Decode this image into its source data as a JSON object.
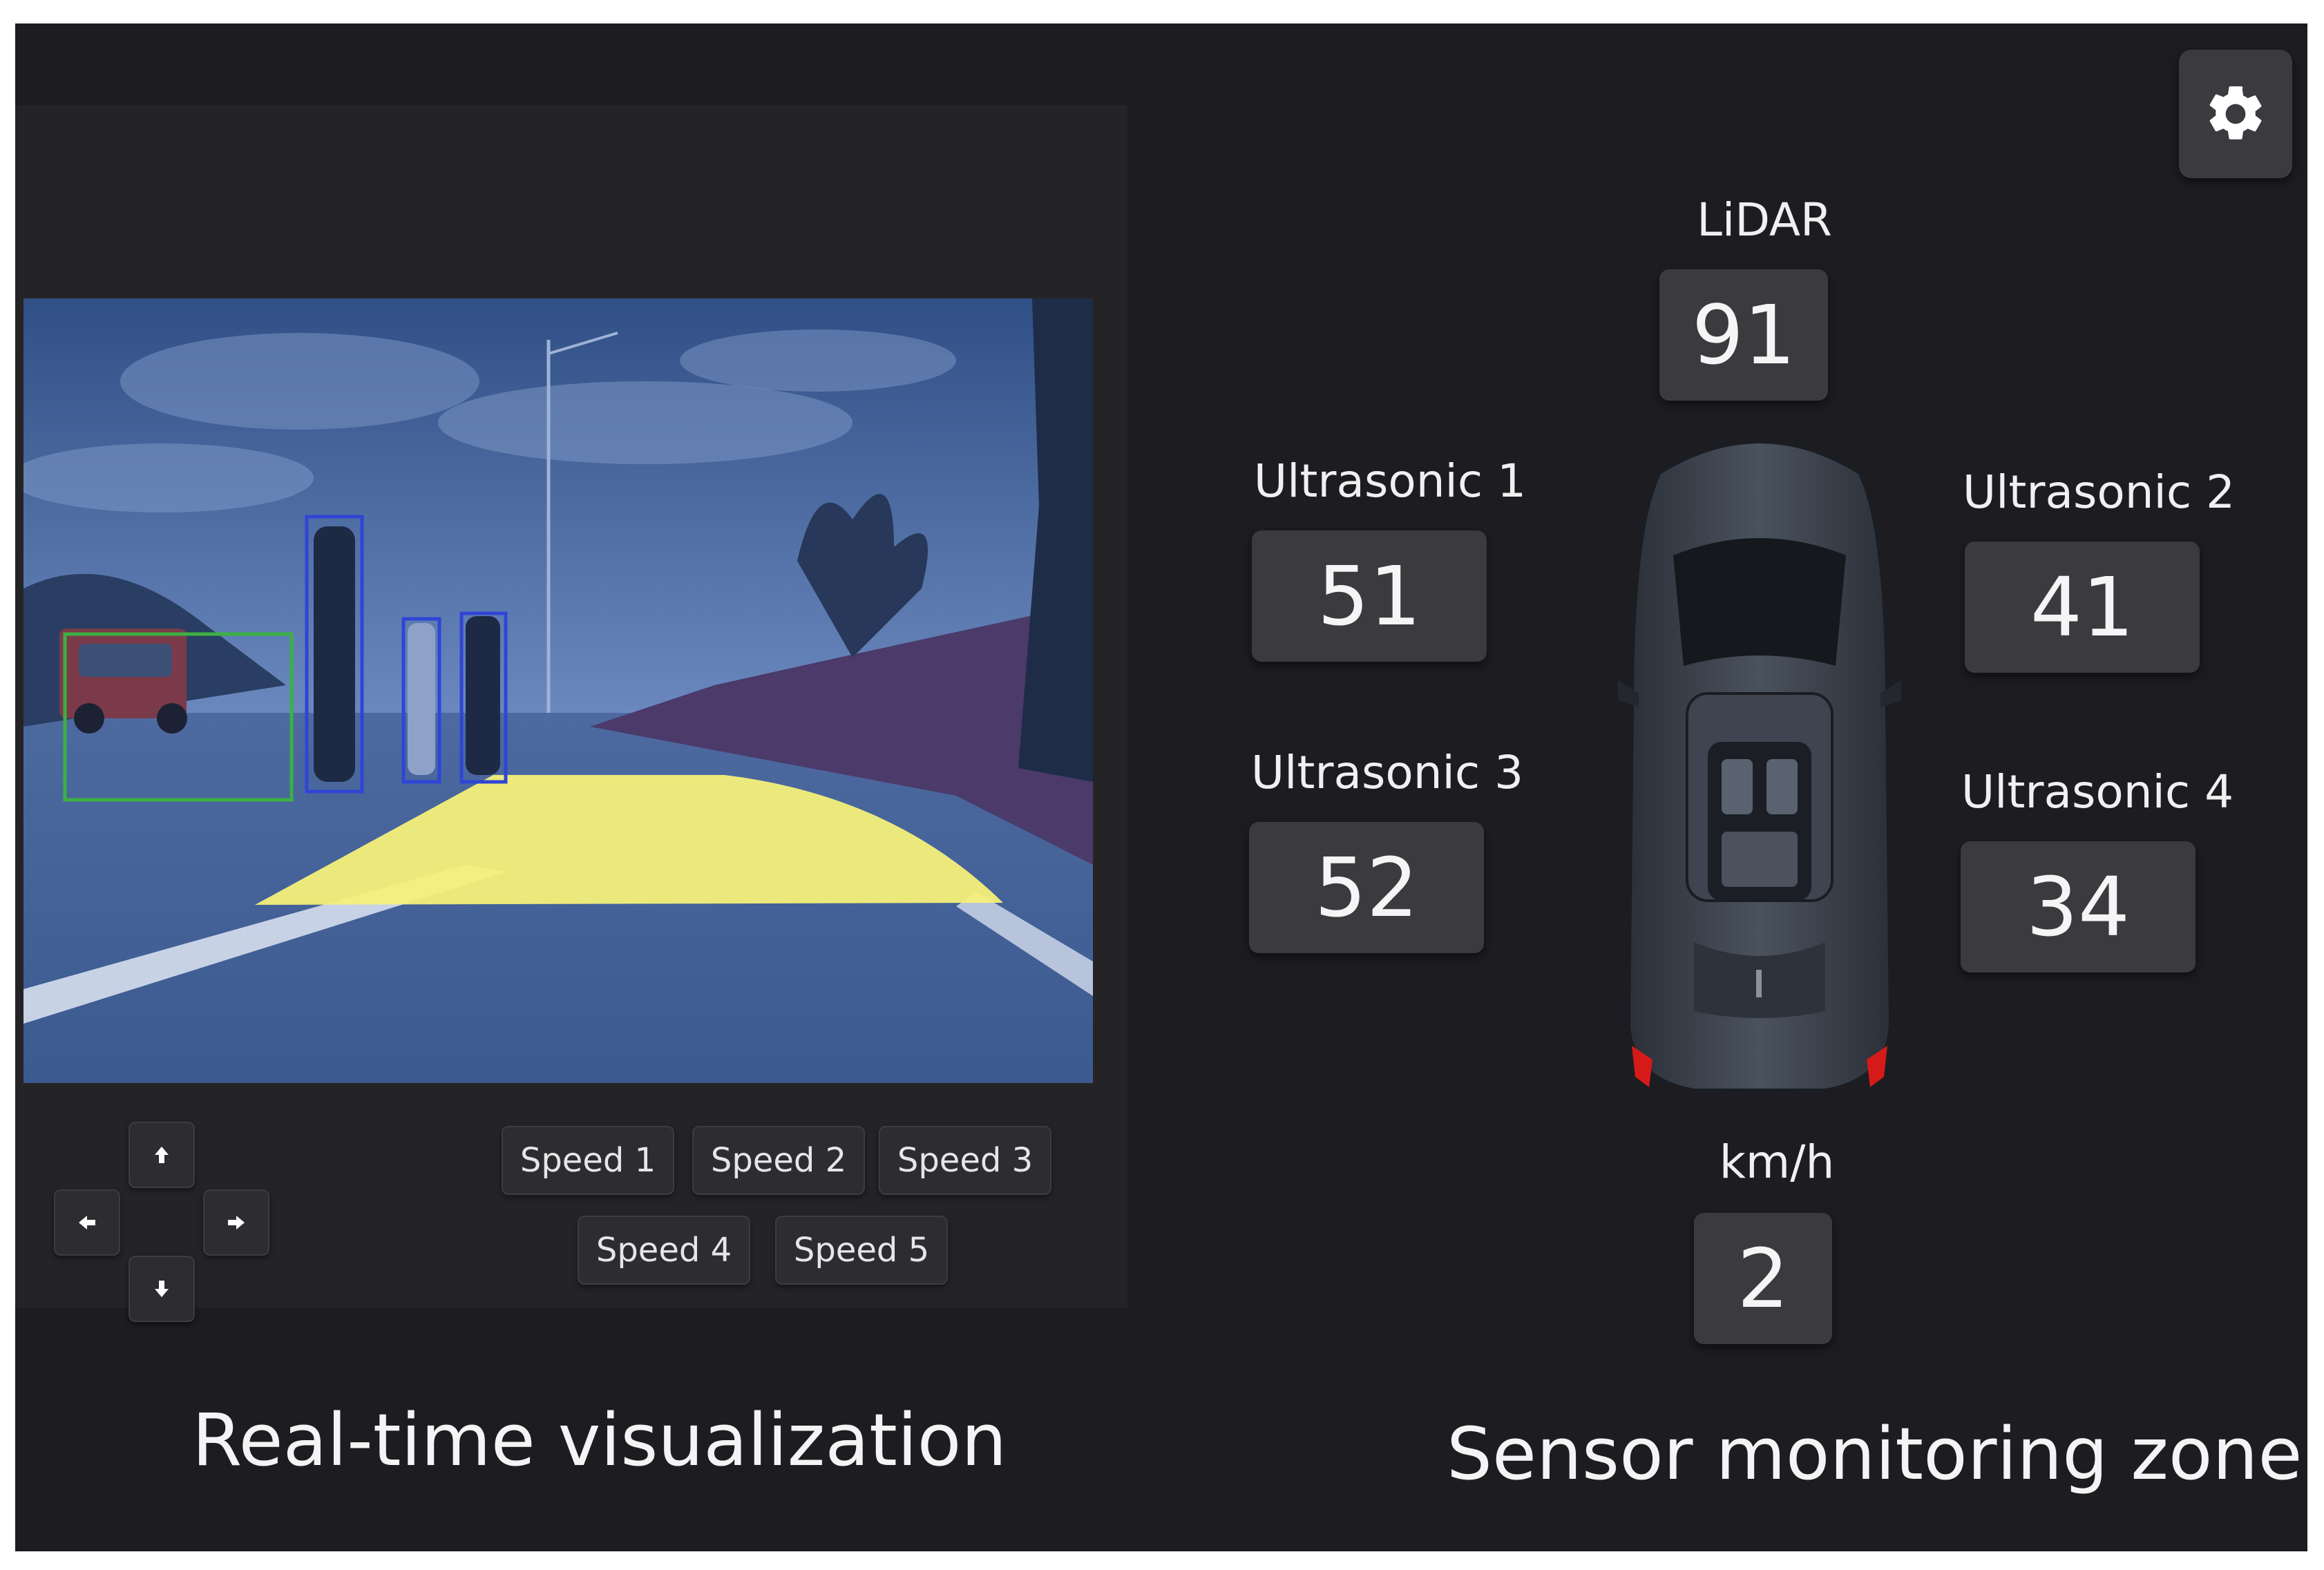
{
  "video_panel": {
    "controls": {
      "up_icon": "arrow-up-icon",
      "left_icon": "arrow-left-icon",
      "right_icon": "arrow-right-icon",
      "down_icon": "arrow-down-icon"
    },
    "speed_buttons": [
      "Speed 1",
      "Speed 2",
      "Speed 3",
      "Speed 4",
      "Speed 5"
    ],
    "caption": "Real-time visualization"
  },
  "sensor_panel": {
    "lidar": {
      "label": "LiDAR",
      "value": "91"
    },
    "ultrasonic_1": {
      "label": "Ultrasonic 1",
      "value": "51"
    },
    "ultrasonic_2": {
      "label": "Ultrasonic 2",
      "value": "41"
    },
    "ultrasonic_3": {
      "label": "Ultrasonic 3",
      "value": "52"
    },
    "ultrasonic_4": {
      "label": "Ultrasonic 4",
      "value": "34"
    },
    "speed": {
      "label": "km/h",
      "value": "2"
    },
    "caption": "Sensor monitoring zone"
  },
  "settings": {
    "icon": "gear-icon"
  },
  "colors": {
    "background": "#1d1c21",
    "panel": "#242427",
    "value_box": "#3b3b3f",
    "drivable_area": "#f5f07a",
    "vehicle_box": "#3cb043",
    "pedestrian_box": "#2f45d6"
  }
}
